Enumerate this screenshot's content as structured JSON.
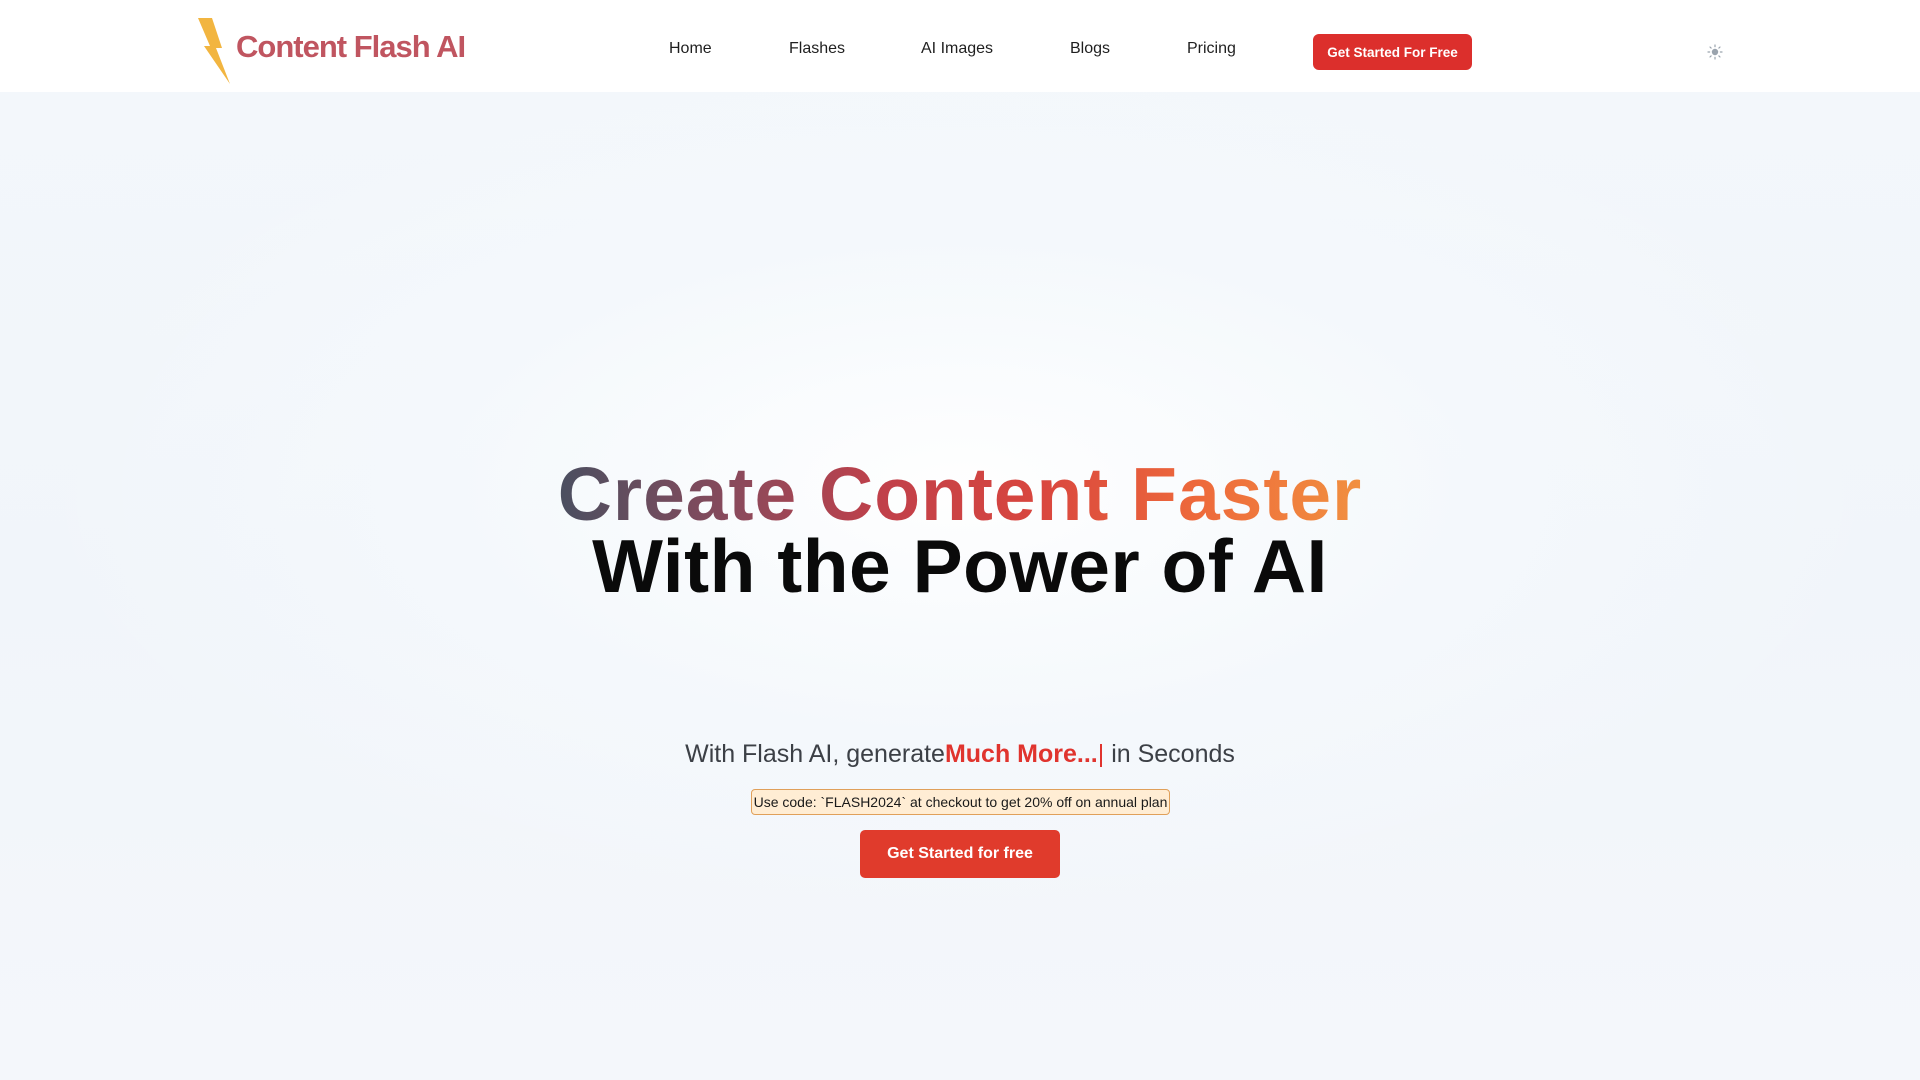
{
  "header": {
    "brand": {
      "name": "Content Flash AI",
      "logo_icon": "lightning-bolt-icon",
      "logo_color": "#f2b540",
      "name_color": "#c05560"
    },
    "nav": [
      {
        "label": "Home"
      },
      {
        "label": "Flashes"
      },
      {
        "label": "AI Images"
      },
      {
        "label": "Blogs"
      },
      {
        "label": "Pricing"
      }
    ],
    "cta_label": "Get Started For Free",
    "cta_color": "#dc2f2c",
    "theme_toggle_icon": "sun-icon"
  },
  "hero": {
    "title_line1": "Create Content Faster",
    "title_line2": "With the Power of AI",
    "subtitle_prefix": "With Flash AI, generate",
    "subtitle_highlight": "Much More...",
    "subtitle_cursor": "|",
    "subtitle_suffix": " in Seconds",
    "promo_text": "Use code: `FLASH2024` at checkout to get 20% off on annual plan",
    "cta_label": "Get Started for free",
    "accent_color": "#e0342e"
  }
}
